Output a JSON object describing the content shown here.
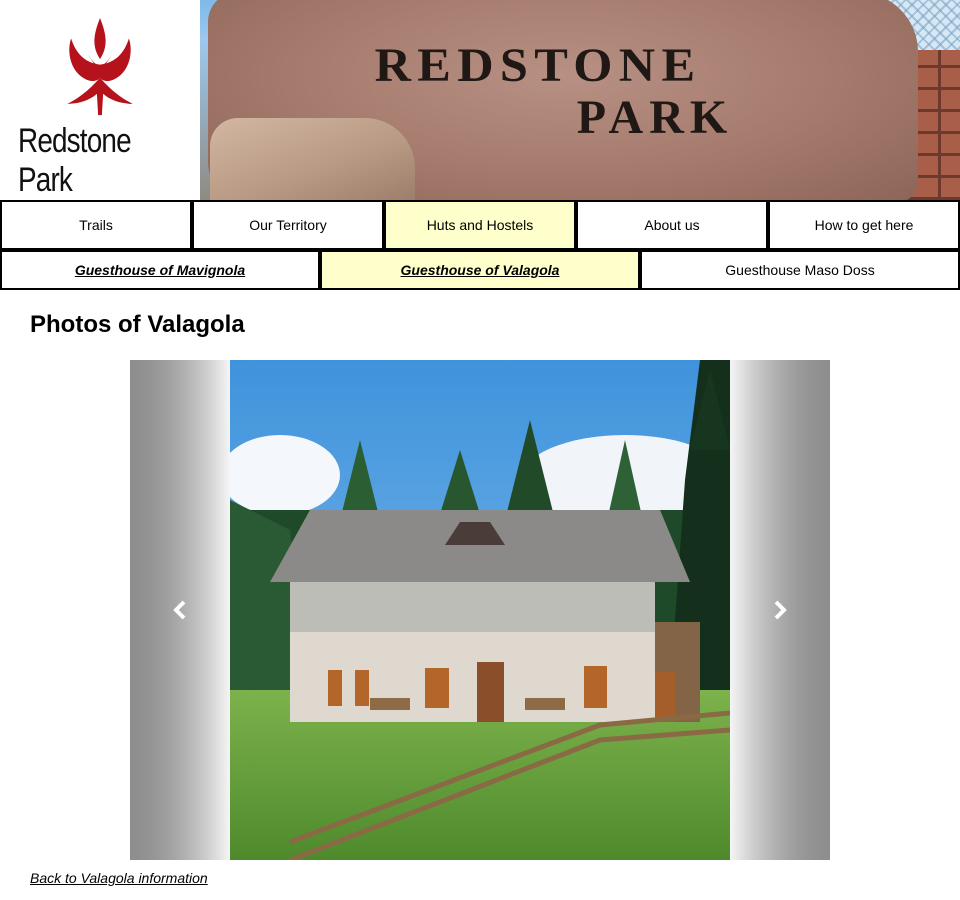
{
  "header": {
    "logo_text": "Redstone Park",
    "banner_line1": "REDSTONE",
    "banner_line2": "PARK",
    "colors": {
      "logo_red": "#b5121b",
      "sign_stone": "#a47a6c",
      "sign_text": "#1f1815"
    }
  },
  "nav": {
    "primary": [
      {
        "label": "Trails",
        "active": false
      },
      {
        "label": "Our Territory",
        "active": false
      },
      {
        "label": "Huts and Hostels",
        "active": true
      },
      {
        "label": "About us",
        "active": false
      },
      {
        "label": "How to get here",
        "active": false
      }
    ],
    "secondary": [
      {
        "label": "Guesthouse of Mavignola",
        "active": false,
        "link": true
      },
      {
        "label": "Guesthouse of Valagola",
        "active": true,
        "link": true
      },
      {
        "label": "Guesthouse Maso Doss",
        "active": false,
        "link": false
      }
    ],
    "active_color": "#ffffcc"
  },
  "main": {
    "title": "Photos of Valagola",
    "carousel": {
      "prev_icon": "chevron-left-icon",
      "next_icon": "chevron-right-icon",
      "photo": "stone guesthouse in meadow with wooden fence"
    },
    "back_link": "Back to Valagola information"
  }
}
